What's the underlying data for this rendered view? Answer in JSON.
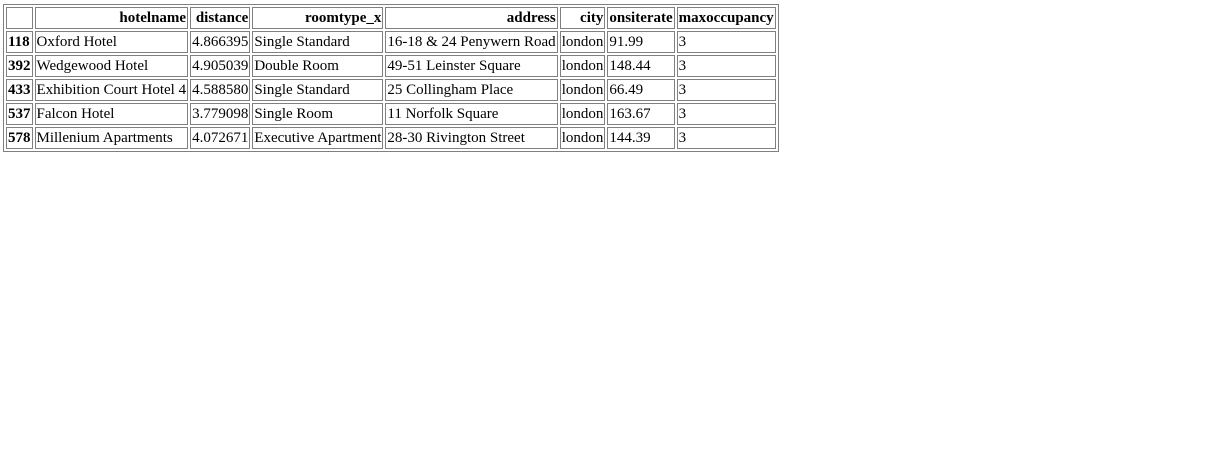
{
  "table": {
    "index_header": "",
    "columns": [
      "hotelname",
      "distance",
      "roomtype_x",
      "address",
      "city",
      "onsiterate",
      "maxoccupancy"
    ],
    "rows": [
      {
        "index": "118",
        "cells": [
          "Oxford Hotel",
          "4.866395",
          "Single Standard",
          "16-18 & 24 Penywern Road",
          "london",
          "91.99",
          "3"
        ]
      },
      {
        "index": "392",
        "cells": [
          "Wedgewood Hotel",
          "4.905039",
          "Double Room",
          "49-51 Leinster Square",
          "london",
          "148.44",
          "3"
        ]
      },
      {
        "index": "433",
        "cells": [
          "Exhibition Court Hotel 4",
          "4.588580",
          "Single Standard",
          "25 Collingham Place",
          "london",
          "66.49",
          "3"
        ]
      },
      {
        "index": "537",
        "cells": [
          "Falcon Hotel",
          "3.779098",
          "Single Room",
          "11 Norfolk Square",
          "london",
          "163.67",
          "3"
        ]
      },
      {
        "index": "578",
        "cells": [
          "Millenium Apartments",
          "4.072671",
          "Executive Apartment",
          "28-30 Rivington Street",
          "london",
          "144.39",
          "3"
        ]
      }
    ]
  }
}
